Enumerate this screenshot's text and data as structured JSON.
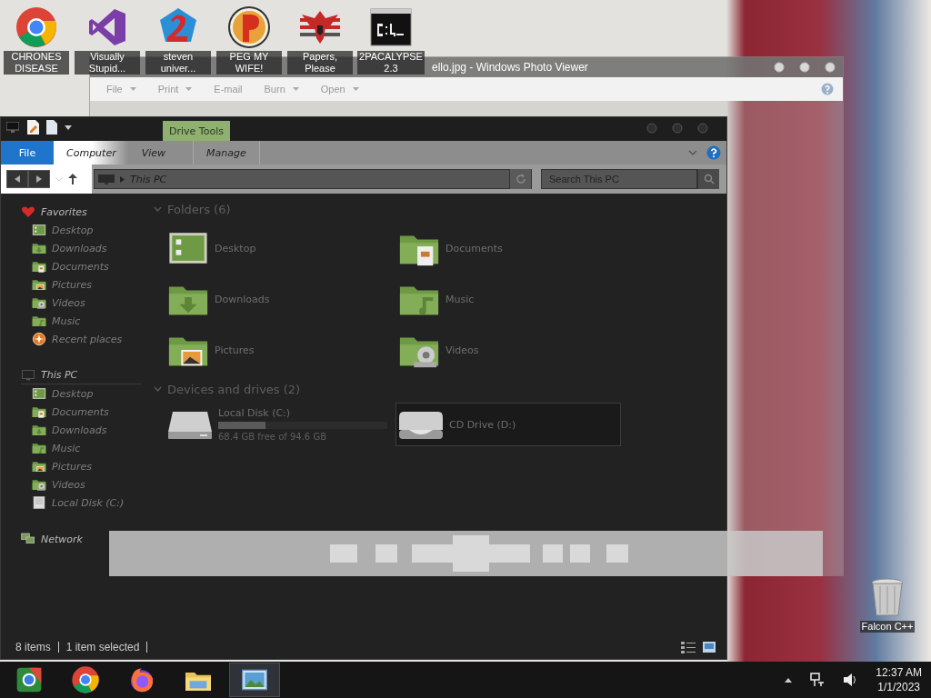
{
  "desktop_icons": [
    {
      "label": "CHRONES DISEASE",
      "kind": "chrome"
    },
    {
      "label": "Visually Stupid...",
      "kind": "vs"
    },
    {
      "label": "steven univer...",
      "kind": "gem"
    },
    {
      "label": "PEG MY WIFE!",
      "kind": "peg"
    },
    {
      "label": "Papers, Please",
      "kind": "eagle"
    },
    {
      "label": "2PACALYPSE 2.3",
      "kind": "cmd"
    }
  ],
  "recycle_bin": {
    "label": "Falcon C++"
  },
  "photo_viewer": {
    "title": "ello.jpg - Windows Photo Viewer",
    "menu": [
      {
        "label": "File",
        "dropdown": true
      },
      {
        "label": "Print",
        "dropdown": true
      },
      {
        "label": "E-mail",
        "dropdown": false
      },
      {
        "label": "Burn",
        "dropdown": true
      },
      {
        "label": "Open",
        "dropdown": true
      }
    ]
  },
  "explorer": {
    "context_tab": "Drive Tools",
    "tabs": [
      {
        "label": "File",
        "kind": "file"
      },
      {
        "label": "Computer",
        "kind": "tab"
      },
      {
        "label": "View",
        "kind": "tab"
      },
      {
        "label": "Manage",
        "kind": "context"
      }
    ],
    "address": "This PC",
    "search": {
      "placeholder": "Search This PC"
    },
    "sidebar": [
      {
        "label": "Favorites",
        "kind": "heart",
        "children": [
          {
            "label": "Desktop",
            "kind": "desktop"
          },
          {
            "label": "Downloads",
            "kind": "downloads"
          },
          {
            "label": "Documents",
            "kind": "documents"
          },
          {
            "label": "Pictures",
            "kind": "pictures"
          },
          {
            "label": "Videos",
            "kind": "videos"
          },
          {
            "label": "Music",
            "kind": "music"
          },
          {
            "label": "Recent places",
            "kind": "recent"
          }
        ]
      },
      {
        "label": "This PC",
        "kind": "computer",
        "children": [
          {
            "label": "Desktop",
            "kind": "desktop"
          },
          {
            "label": "Documents",
            "kind": "documents"
          },
          {
            "label": "Downloads",
            "kind": "downloads"
          },
          {
            "label": "Music",
            "kind": "music"
          },
          {
            "label": "Pictures",
            "kind": "pictures"
          },
          {
            "label": "Videos",
            "kind": "videos"
          },
          {
            "label": "Local Disk (C:)",
            "kind": "disk"
          }
        ]
      },
      {
        "label": "Network",
        "kind": "network"
      }
    ],
    "sections": [
      {
        "title": "Folders (6)",
        "items": [
          {
            "label": "Desktop",
            "kind": "desktop",
            "selected": false
          },
          {
            "label": "Documents",
            "kind": "documents",
            "selected": false
          },
          {
            "label": "Downloads",
            "kind": "downloads",
            "selected": false
          },
          {
            "label": "Music",
            "kind": "music",
            "selected": false
          },
          {
            "label": "Pictures",
            "kind": "pictures",
            "selected": false
          },
          {
            "label": "Videos",
            "kind": "videos",
            "selected": false
          }
        ]
      },
      {
        "title": "Devices and drives (2)",
        "items": [
          {
            "label": "Local Disk (C:)",
            "kind": "disk",
            "selected": false,
            "level": 0.277,
            "detail": "68.4 GB free of 94.6 GB"
          },
          {
            "label": "CD Drive (D:)",
            "kind": "cd",
            "selected": true
          }
        ]
      }
    ],
    "status": [
      "8 items",
      "1 item selected"
    ]
  },
  "taskbar": {
    "items": [
      {
        "kind": "chrome-dev",
        "selected": false
      },
      {
        "kind": "chrome",
        "selected": false
      },
      {
        "kind": "firefox",
        "selected": false
      },
      {
        "kind": "explorer",
        "selected": false
      },
      {
        "kind": "photos",
        "selected": true
      }
    ],
    "time": "12:37 AM",
    "date": "1/1/2023"
  }
}
